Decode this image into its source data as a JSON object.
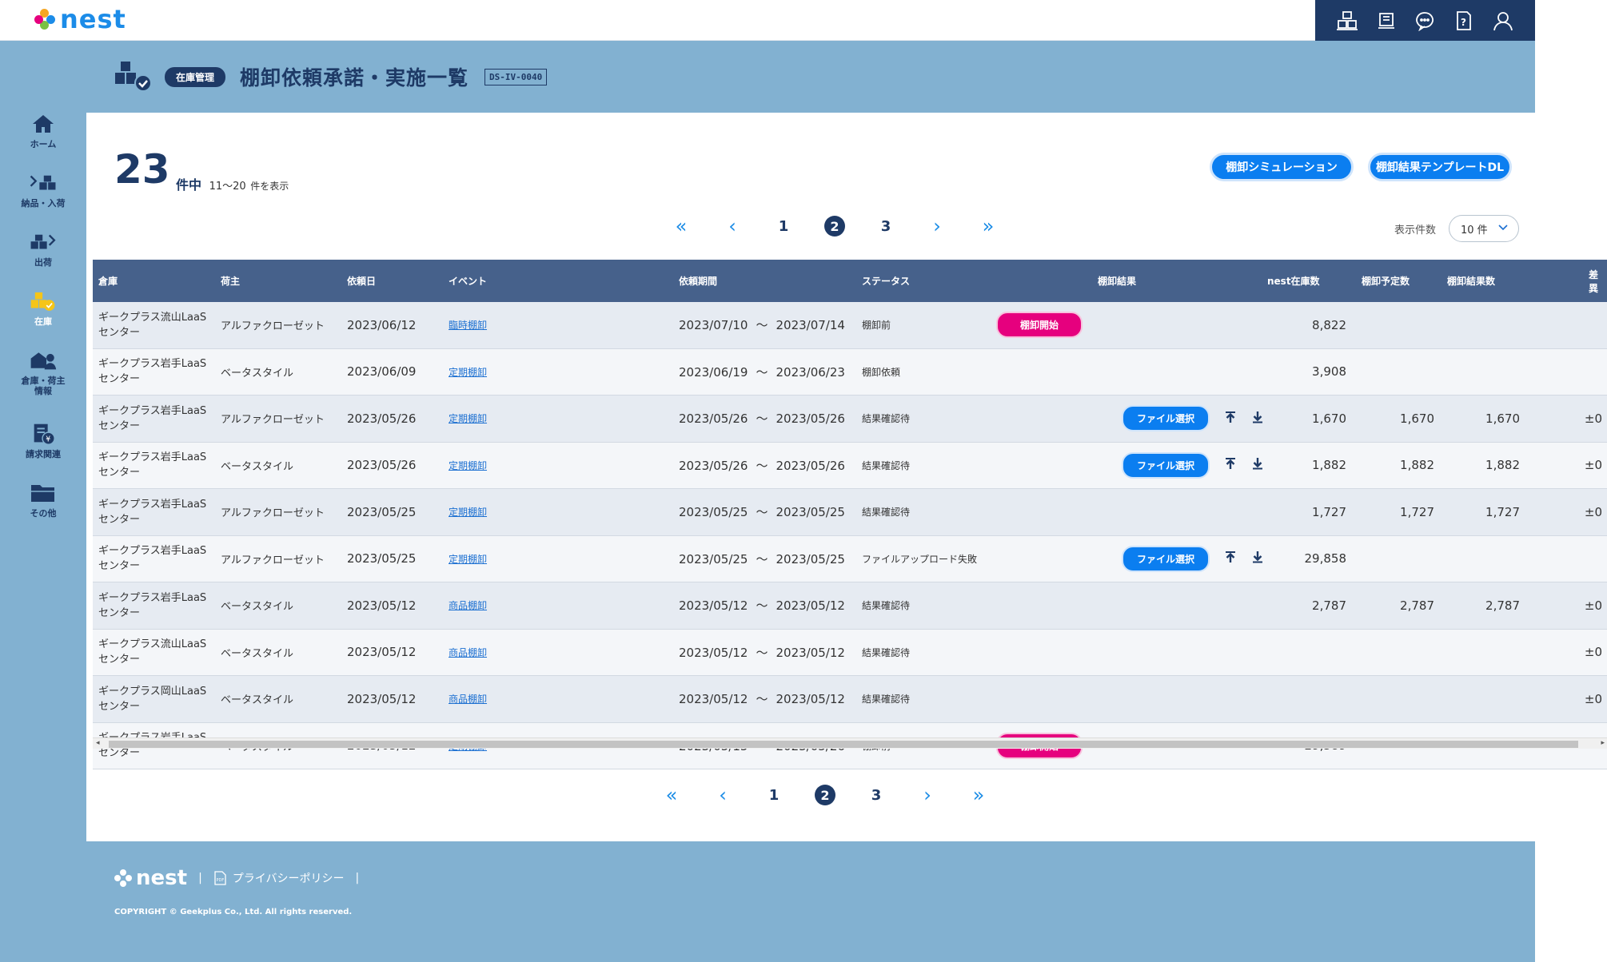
{
  "app": {
    "logo_text": "nest",
    "brand_color": "#1c8ce8",
    "header_dark": "#1e3a66"
  },
  "top_icons": [
    "inventory-board-icon",
    "manual-book-icon",
    "chat-icon",
    "help-doc-icon",
    "user-icon"
  ],
  "sidebar": {
    "items": [
      {
        "label": "ホーム",
        "icon": "home-icon"
      },
      {
        "label": "納品・入荷",
        "icon": "inbound-icon"
      },
      {
        "label": "出荷",
        "icon": "outbound-icon"
      },
      {
        "label": "在庫",
        "icon": "inventory-icon",
        "active": true
      },
      {
        "label": "倉庫・荷主情報",
        "icon": "warehouse-owner-icon"
      },
      {
        "label": "請求関連",
        "icon": "billing-icon"
      },
      {
        "label": "その他",
        "icon": "folder-icon"
      }
    ]
  },
  "header": {
    "badge": "在庫管理",
    "title": "棚卸依頼承諾・実施一覧",
    "code": "DS-IV-0040"
  },
  "summary": {
    "total": "23",
    "unit": "件中",
    "range": "11～20",
    "suffix": "件を表示"
  },
  "actions": {
    "simulation": "棚卸シミュレーション",
    "template_dl": "棚卸結果テンプレートDL"
  },
  "pagination": {
    "pages": [
      "1",
      "2",
      "3"
    ],
    "current": "2"
  },
  "page_size": {
    "label": "表示件数",
    "value": "10 件"
  },
  "table": {
    "columns": {
      "warehouse": "倉庫",
      "owner": "荷主",
      "request_date": "依頼日",
      "event": "イベント",
      "period": "依頼期間",
      "status": "ステータス",
      "result": "棚卸結果",
      "stock": "nest在庫数",
      "planned": "棚卸予定数",
      "result_count": "棚卸結果数",
      "diff": "差異"
    },
    "start_label": "棚卸開始",
    "file_button": "ファイル選択",
    "tilde": "～",
    "rows": [
      {
        "warehouse1": "ギークプラス流山LaaS",
        "warehouse2": "センター",
        "owner": "アルファクローゼット",
        "date": "2023/06/12",
        "event": "臨時棚卸",
        "from": "2023/07/10",
        "to": "2023/07/14",
        "status": "棚卸前",
        "action": "start",
        "stock": "8,822",
        "planned": "",
        "result": "",
        "diff": ""
      },
      {
        "warehouse1": "ギークプラス岩手LaaS",
        "warehouse2": "センター",
        "owner": "ベータスタイル",
        "date": "2023/06/09",
        "event": "定期棚卸",
        "from": "2023/06/19",
        "to": "2023/06/23",
        "status": "棚卸依頼",
        "action": "",
        "stock": "3,908",
        "planned": "",
        "result": "",
        "diff": ""
      },
      {
        "warehouse1": "ギークプラス岩手LaaS",
        "warehouse2": "センター",
        "owner": "アルファクローゼット",
        "date": "2023/05/26",
        "event": "定期棚卸",
        "from": "2023/05/26",
        "to": "2023/05/26",
        "status": "結果確認待",
        "action": "file",
        "stock": "1,670",
        "planned": "1,670",
        "result": "1,670",
        "diff": "±0"
      },
      {
        "warehouse1": "ギークプラス岩手LaaS",
        "warehouse2": "センター",
        "owner": "ベータスタイル",
        "date": "2023/05/26",
        "event": "定期棚卸",
        "from": "2023/05/26",
        "to": "2023/05/26",
        "status": "結果確認待",
        "action": "file",
        "stock": "1,882",
        "planned": "1,882",
        "result": "1,882",
        "diff": "±0"
      },
      {
        "warehouse1": "ギークプラス岩手LaaS",
        "warehouse2": "センター",
        "owner": "アルファクローゼット",
        "date": "2023/05/25",
        "event": "定期棚卸",
        "from": "2023/05/25",
        "to": "2023/05/25",
        "status": "結果確認待",
        "action": "",
        "stock": "1,727",
        "planned": "1,727",
        "result": "1,727",
        "diff": "±0"
      },
      {
        "warehouse1": "ギークプラス岩手LaaS",
        "warehouse2": "センター",
        "owner": "アルファクローゼット",
        "date": "2023/05/25",
        "event": "定期棚卸",
        "from": "2023/05/25",
        "to": "2023/05/25",
        "status": "ファイルアップロード失敗",
        "action": "file",
        "stock": "29,858",
        "planned": "",
        "result": "",
        "diff": ""
      },
      {
        "warehouse1": "ギークプラス岩手LaaS",
        "warehouse2": "センター",
        "owner": "ベータスタイル",
        "date": "2023/05/12",
        "event": "商品棚卸",
        "from": "2023/05/12",
        "to": "2023/05/12",
        "status": "結果確認待",
        "action": "",
        "stock": "2,787",
        "planned": "2,787",
        "result": "2,787",
        "diff": "±0"
      },
      {
        "warehouse1": "ギークプラス流山LaaS",
        "warehouse2": "センター",
        "owner": "ベータスタイル",
        "date": "2023/05/12",
        "event": "商品棚卸",
        "from": "2023/05/12",
        "to": "2023/05/12",
        "status": "結果確認待",
        "action": "",
        "stock": "",
        "planned": "",
        "result": "",
        "diff": "±0"
      },
      {
        "warehouse1": "ギークプラス岡山LaaS",
        "warehouse2": "センター",
        "owner": "ベータスタイル",
        "date": "2023/05/12",
        "event": "商品棚卸",
        "from": "2023/05/12",
        "to": "2023/05/12",
        "status": "結果確認待",
        "action": "",
        "stock": "",
        "planned": "",
        "result": "",
        "diff": "±0"
      },
      {
        "warehouse1": "ギークプラス岩手LaaS",
        "warehouse2": "センター",
        "owner": "ベータスタイル",
        "date": "2023/05/12",
        "event": "定期棚卸",
        "from": "2023/05/15",
        "to": "2023/05/26",
        "status": "棚卸前",
        "action": "start",
        "stock": "29,589",
        "planned": "",
        "result": "",
        "diff": ""
      }
    ]
  },
  "footer": {
    "logo_text": "nest",
    "privacy": "プライバシーポリシー",
    "sep": "|",
    "copyright": "COPYRIGHT © Geekplus Co., Ltd. All rights reserved."
  }
}
